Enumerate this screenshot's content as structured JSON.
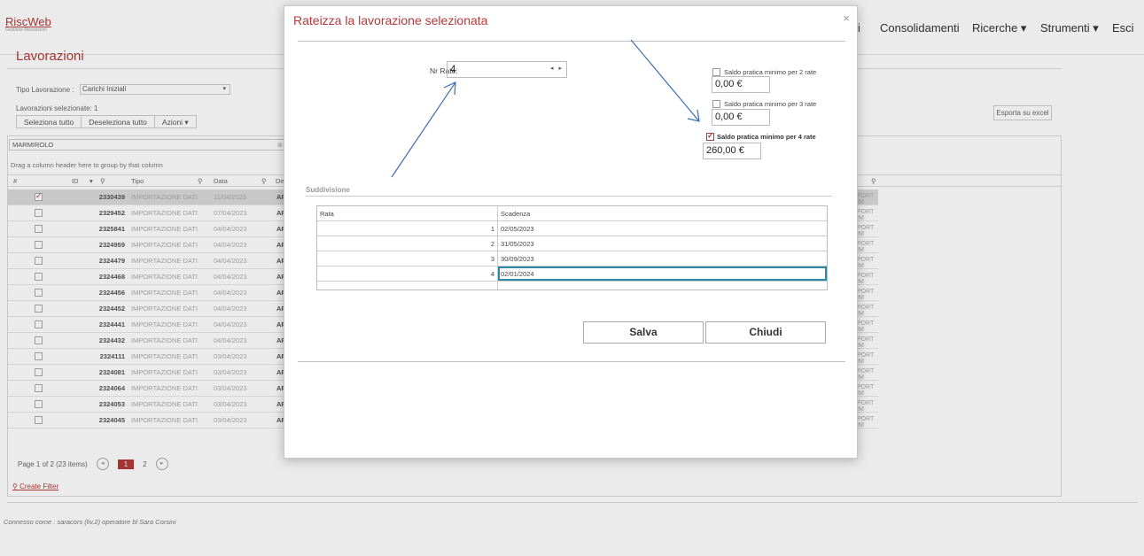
{
  "app": {
    "logo": "RiscWeb",
    "logo_sub": "Gestione Riscossioni"
  },
  "nav": {
    "items": [
      "i",
      "Consolidamenti",
      "Ricerche ▾",
      "Strumenti ▾",
      "Esci"
    ]
  },
  "page": {
    "title": "Lavorazioni",
    "tipo_label": "Tipo Lavorazione :",
    "tipo_value": "Carichi Iniziali",
    "selected_label": "Lavorazioni selezionate: 1",
    "buttons": [
      "Seleziona tutto",
      "Deseleziona tutto",
      "Azioni ▾"
    ],
    "export": "Esporta su excel",
    "filter_value": "MARMIROLO",
    "drag_hint": "Drag a column header here to group by that column",
    "columns": [
      "#",
      "ID",
      "Tipo",
      "Data",
      "De"
    ],
    "rows": [
      {
        "id": "2330439",
        "tipo": "IMPORTAZIONE DATI",
        "data": "11/04/2023",
        "checked": true
      },
      {
        "id": "2329452",
        "tipo": "IMPORTAZIONE DATI",
        "data": "07/04/2023",
        "checked": false
      },
      {
        "id": "2325841",
        "tipo": "IMPORTAZIONE DATI",
        "data": "04/04/2023",
        "checked": false
      },
      {
        "id": "2324959",
        "tipo": "IMPORTAZIONE DATI",
        "data": "04/04/2023",
        "checked": false
      },
      {
        "id": "2324479",
        "tipo": "IMPORTAZIONE DATI",
        "data": "04/04/2023",
        "checked": false
      },
      {
        "id": "2324468",
        "tipo": "IMPORTAZIONE DATI",
        "data": "04/04/2023",
        "checked": false
      },
      {
        "id": "2324456",
        "tipo": "IMPORTAZIONE DATI",
        "data": "04/04/2023",
        "checked": false
      },
      {
        "id": "2324452",
        "tipo": "IMPORTAZIONE DATI",
        "data": "04/04/2023",
        "checked": false
      },
      {
        "id": "2324441",
        "tipo": "IMPORTAZIONE DATI",
        "data": "04/04/2023",
        "checked": false
      },
      {
        "id": "2324432",
        "tipo": "IMPORTAZIONE DATI",
        "data": "04/04/2023",
        "checked": false
      },
      {
        "id": "2324111",
        "tipo": "IMPORTAZIONE DATI",
        "data": "03/04/2023",
        "checked": false
      },
      {
        "id": "2324081",
        "tipo": "IMPORTAZIONE DATI",
        "data": "03/04/2023",
        "checked": false
      },
      {
        "id": "2324064",
        "tipo": "IMPORTAZIONE DATI",
        "data": "03/04/2023",
        "checked": false
      },
      {
        "id": "2324053",
        "tipo": "IMPORTAZIONE DATI",
        "data": "03/04/2023",
        "checked": false
      },
      {
        "id": "2324045",
        "tipo": "IMPORTAZIONE DATI",
        "data": "03/04/2023",
        "checked": false
      }
    ],
    "row_ap": "AP",
    "row_right": "PORT IM",
    "pager_info": "Page 1 of 2 (23 items)",
    "pager_current": "1",
    "pager_next": "2",
    "create_filter": "Create Filter",
    "connected": "Connesso come : saracors (liv.2) operatore bl Sara Corsini"
  },
  "modal": {
    "title": "Rateizza la lavorazione selezionata",
    "close": "×",
    "nr_rate_label": "Nr Rate:",
    "nr_rate_value": "4",
    "nr_rate_arrows": "◂ ▸",
    "saldo2_label": "Saldo pratica minimo per 2 rate",
    "saldo2_value": "0,00 €",
    "saldo2_checked": false,
    "saldo3_label": "Saldo pratica minimo per 3 rate",
    "saldo3_value": "0,00 €",
    "saldo3_checked": false,
    "saldo4_label": "Saldo pratica minimo per 4 rate",
    "saldo4_value": "260,00 €",
    "saldo4_checked": true,
    "suddivisione_label": "Suddivisione",
    "table_headers": {
      "rata": "Rata",
      "scadenza": "Scadenza"
    },
    "table_rows": [
      {
        "rata": "1",
        "scadenza": "02/05/2023"
      },
      {
        "rata": "2",
        "scadenza": "31/05/2023"
      },
      {
        "rata": "3",
        "scadenza": "30/09/2023"
      },
      {
        "rata": "4",
        "scadenza": "02/01/2024"
      }
    ],
    "save_label": "Salva",
    "close_label": "Chiudi"
  },
  "colors": {
    "accent": "#b43a3a",
    "arrow": "#3b6fb0",
    "focus": "#2a8aa5"
  }
}
